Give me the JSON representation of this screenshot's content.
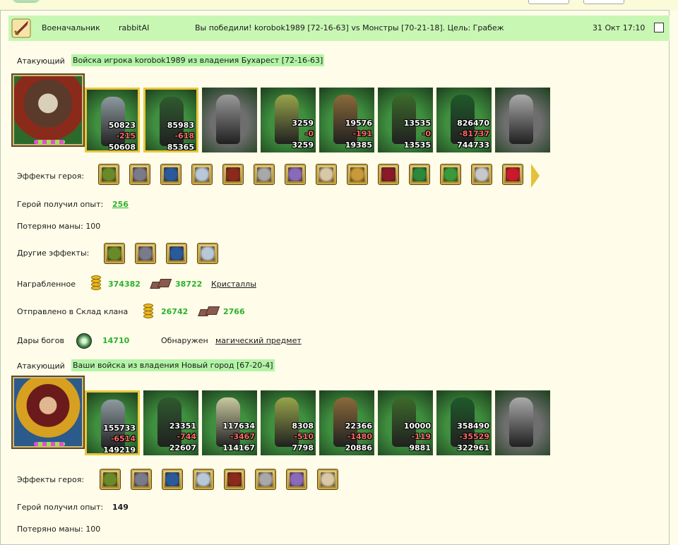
{
  "header": {
    "role": "Военачальник",
    "player": "rabbitAI",
    "message": "Вы победили! korobok1989 [72-16-63] vs Монстры [70-21-18]. Цель: Грабеж",
    "datetime": "31 Окт 17:10"
  },
  "army1": {
    "attacker_label": "Атакующий",
    "title": "Войска игрока korobok1989 из владения Бухарест [72-16-63]",
    "units": [
      {
        "start": "50823",
        "lost": "-215",
        "end": "50608",
        "color": "#3f8f3f",
        "fig": "#8d9aa0",
        "gold": true
      },
      {
        "start": "85983",
        "lost": "-618",
        "end": "85365",
        "color": "#3f8f3f",
        "fig": "#2f5a2f",
        "gold": true
      },
      {
        "start": "",
        "lost": "",
        "end": "",
        "color": "#6e6e6e",
        "fig": "#9a9a9a",
        "gold": false
      },
      {
        "start": "3259",
        "lost": "-0",
        "end": "3259",
        "color": "#3f8f3f",
        "fig": "#98a44a",
        "gold": false
      },
      {
        "start": "19576",
        "lost": "-191",
        "end": "19385",
        "color": "#3f8f3f",
        "fig": "#8a6a3a",
        "gold": false
      },
      {
        "start": "13535",
        "lost": "-0",
        "end": "13535",
        "color": "#3f8f3f",
        "fig": "#3c6a2a",
        "gold": false
      },
      {
        "start": "826470",
        "lost": "-81737",
        "end": "744733",
        "color": "#3f8f3f",
        "fig": "#1f5a2a",
        "gold": false
      },
      {
        "start": "",
        "lost": "",
        "end": "",
        "color": "#6e6e6e",
        "fig": "#aaaaaa",
        "gold": false
      }
    ],
    "effects_label": "Эффекты героя:",
    "effects": [
      "sun-amulet-icon",
      "helmet-icon",
      "potion-icon",
      "wing-icon",
      "armor-icon",
      "barrel-icon",
      "ring-icon",
      "scroll-icon",
      "shield-icon",
      "chain-icon",
      "handshake-icon",
      "horseshoe-icon",
      "knight-helm-icon",
      "heart-icon"
    ],
    "exp_label": "Герой получил опыт:",
    "exp_value": "256",
    "mana_label": "Потеряно маны: 100",
    "other_label": "Другие эффекты:",
    "other_effects": [
      "heart-icon",
      "fire-shield-icon",
      "gear-hand-icon",
      "potion-bag-icon"
    ],
    "loot_label": "Награбленное",
    "loot_gold": "374382",
    "loot_ore": "38722",
    "loot_link": "Кристаллы",
    "clan_label": "Отправлено в Склад клана",
    "clan_gold": "26742",
    "clan_ore": "2766",
    "gods_label": "Дары богов",
    "gods_value": "14710",
    "found_label": "Обнаружен",
    "found_link": "магический предмет"
  },
  "army2": {
    "attacker_label": "Атакующий",
    "title": "Ваши войска из владения Новый город [67-20-4]",
    "units": [
      {
        "start": "155733",
        "lost": "-6514",
        "end": "149219",
        "color": "#3f8f3f",
        "fig": "#8d9aa0",
        "gold": true
      },
      {
        "start": "23351",
        "lost": "-744",
        "end": "22607",
        "color": "#3f8f3f",
        "fig": "#2f5a2f",
        "gold": false
      },
      {
        "start": "117634",
        "lost": "-3467",
        "end": "114167",
        "color": "#3f8f3f",
        "fig": "#c9c9a0",
        "gold": false
      },
      {
        "start": "8308",
        "lost": "-510",
        "end": "7798",
        "color": "#3f8f3f",
        "fig": "#98a44a",
        "gold": false
      },
      {
        "start": "22366",
        "lost": "-1480",
        "end": "20886",
        "color": "#3f8f3f",
        "fig": "#8a6a3a",
        "gold": false
      },
      {
        "start": "10000",
        "lost": "-119",
        "end": "9881",
        "color": "#3f8f3f",
        "fig": "#3c6a2a",
        "gold": false
      },
      {
        "start": "358490",
        "lost": "-35529",
        "end": "322961",
        "color": "#3f8f3f",
        "fig": "#1f5a2a",
        "gold": false
      },
      {
        "start": "",
        "lost": "",
        "end": "",
        "color": "#6e6e6e",
        "fig": "#aaaaaa",
        "gold": false
      }
    ],
    "effects_label": "Эффекты героя:",
    "effects": [
      "web-icon",
      "armor-icon",
      "bow-icon",
      "boots-icon",
      "fire-wing-icon",
      "sword-icon",
      "crossed-swords-icon",
      "handshake-icon"
    ],
    "exp_label": "Герой получил опыт:",
    "exp_value": "149",
    "mana_label": "Потеряно маны: 100"
  }
}
